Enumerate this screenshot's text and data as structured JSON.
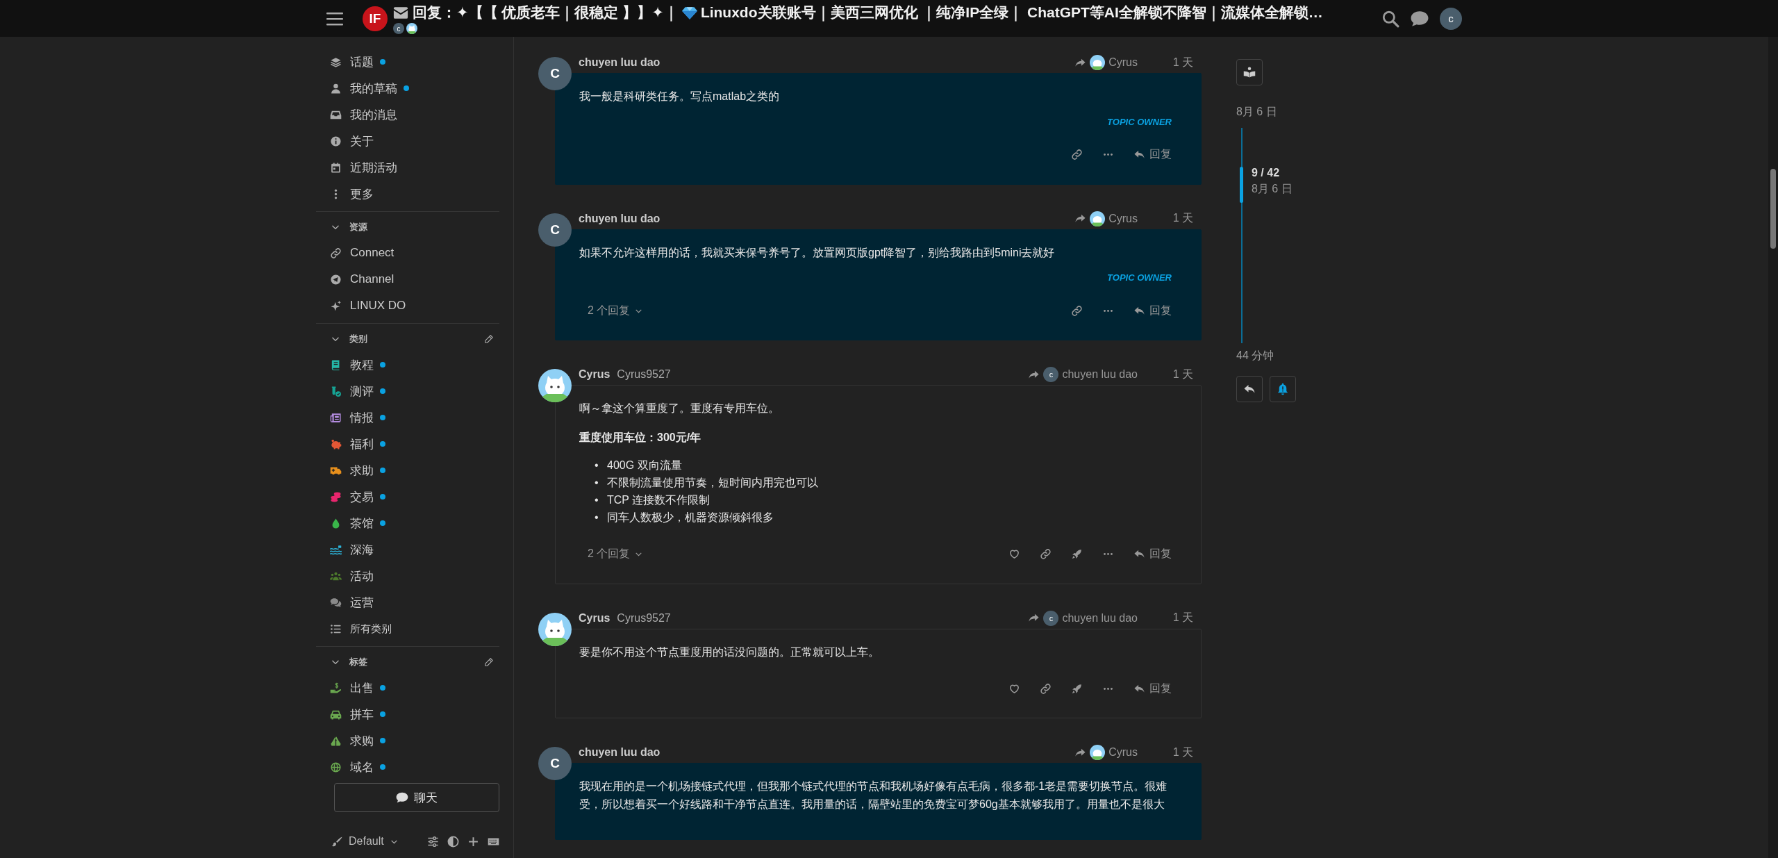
{
  "header": {
    "logo_text": "IF",
    "title_start": "回复：✦【【 优质老车｜很稳定 】】✦｜",
    "title_end": "Linuxdo关联账号｜美西三网优化 ｜纯净IP全绿｜ ChatGPT等AI全解锁不降智｜流媒体全解锁…",
    "participants": [
      {
        "kind": "letter",
        "letter": "c"
      },
      {
        "kind": "cat"
      }
    ],
    "user_letter": "c"
  },
  "sidebar": {
    "items": [
      {
        "label": "话题",
        "unread": true
      },
      {
        "label": "我的草稿",
        "unread": true
      },
      {
        "label": "我的消息",
        "unread": false
      },
      {
        "label": "关于",
        "unread": false
      },
      {
        "label": "近期活动",
        "unread": false
      },
      {
        "label": "更多",
        "unread": false
      }
    ],
    "sections": [
      {
        "title": "资源",
        "expanded": true,
        "editable": false,
        "items": [
          {
            "label": "Connect",
            "unread": false
          },
          {
            "label": "Channel",
            "unread": false
          },
          {
            "label": "LINUX DO",
            "unread": false
          }
        ]
      },
      {
        "title": "类别",
        "expanded": true,
        "editable": true,
        "items": [
          {
            "label": "教程",
            "unread": true,
            "color": "#25b8a8"
          },
          {
            "label": "测评",
            "unread": true,
            "color": "#16a394"
          },
          {
            "label": "情报",
            "unread": true,
            "color": "#b48ce0"
          },
          {
            "label": "福利",
            "unread": true,
            "color": "#e45735"
          },
          {
            "label": "求助",
            "unread": true,
            "color": "#e8901c"
          },
          {
            "label": "交易",
            "unread": true,
            "color": "#e8266e"
          },
          {
            "label": "茶馆",
            "unread": true,
            "color": "#3ab54a"
          },
          {
            "label": "深海",
            "unread": false,
            "color": "#2db3d8"
          },
          {
            "label": "活动",
            "unread": false,
            "color": "#4d7a2c"
          },
          {
            "label": "运营",
            "unread": false,
            "color": "#8a8a8a"
          },
          {
            "label": "所有类别",
            "unread": false
          }
        ]
      },
      {
        "title": "标签",
        "expanded": true,
        "editable": true,
        "items": [
          {
            "label": "出售",
            "unread": true
          },
          {
            "label": "拼车",
            "unread": true
          },
          {
            "label": "求购",
            "unread": true
          },
          {
            "label": "域名",
            "unread": true
          }
        ]
      }
    ],
    "chat_button": "聊天",
    "theme": "Default"
  },
  "posts": [
    {
      "author": "chuyen luu dao",
      "avatar": {
        "kind": "letter",
        "letter": "C"
      },
      "reply_to": {
        "name": "Cyrus",
        "avatar": {
          "kind": "cat"
        }
      },
      "time": "1 天",
      "highlighted": true,
      "body": [
        {
          "kind": "p",
          "text": "我一般是科研类任务。写点matlab之类的"
        }
      ],
      "badge": "TOPIC OWNER",
      "actions": [
        {
          "kind": "link"
        },
        {
          "kind": "more"
        },
        {
          "kind": "reply",
          "label": "回复"
        }
      ]
    },
    {
      "author": "chuyen luu dao",
      "avatar": {
        "kind": "letter",
        "letter": "C"
      },
      "reply_to": {
        "name": "Cyrus",
        "avatar": {
          "kind": "cat"
        }
      },
      "time": "1 天",
      "highlighted": true,
      "body": [
        {
          "kind": "p",
          "text": "如果不允许这样用的话，我就买来保号养号了。放置网页版gpt降智了，别给我路由到5mini去就好"
        }
      ],
      "badge": "TOPIC OWNER",
      "replies": "2 个回复",
      "actions": [
        {
          "kind": "link"
        },
        {
          "kind": "more"
        },
        {
          "kind": "reply",
          "label": "回复"
        }
      ]
    },
    {
      "author": "Cyrus",
      "username": "Cyrus9527",
      "avatar": {
        "kind": "cat"
      },
      "reply_to": {
        "name": "chuyen luu dao",
        "avatar": {
          "kind": "letter",
          "letter": "c"
        }
      },
      "time": "1 天",
      "highlighted": false,
      "body": [
        {
          "kind": "p",
          "text": "啊～拿这个算重度了。重度有专用车位。"
        },
        {
          "kind": "strong",
          "text": "重度使用车位：300元/年"
        },
        {
          "kind": "list",
          "items": [
            {
              "marker": "•",
              "text": "400G 双向流量"
            },
            {
              "marker": "•",
              "text": "不限制流量使用节奏，短时间内用完也可以"
            },
            {
              "marker": "•",
              "text": "TCP 连接数不作限制"
            },
            {
              "marker": "•",
              "text": "同车人数极少，机器资源倾斜很多"
            }
          ]
        }
      ],
      "replies": "2 个回复",
      "actions": [
        {
          "kind": "like"
        },
        {
          "kind": "link"
        },
        {
          "kind": "boost"
        },
        {
          "kind": "more"
        },
        {
          "kind": "reply",
          "label": "回复"
        }
      ]
    },
    {
      "author": "Cyrus",
      "username": "Cyrus9527",
      "avatar": {
        "kind": "cat"
      },
      "reply_to": {
        "name": "chuyen luu dao",
        "avatar": {
          "kind": "letter",
          "letter": "c"
        }
      },
      "time": "1 天",
      "highlighted": false,
      "body": [
        {
          "kind": "p",
          "text": "要是你不用这个节点重度用的话没问题的。正常就可以上车。"
        }
      ],
      "actions": [
        {
          "kind": "like"
        },
        {
          "kind": "link"
        },
        {
          "kind": "boost"
        },
        {
          "kind": "more"
        },
        {
          "kind": "reply",
          "label": "回复"
        }
      ]
    },
    {
      "author": "chuyen luu dao",
      "avatar": {
        "kind": "letter",
        "letter": "C"
      },
      "reply_to": {
        "name": "Cyrus",
        "avatar": {
          "kind": "cat"
        }
      },
      "time": "1 天",
      "highlighted": true,
      "body": [
        {
          "kind": "p",
          "text": "我现在用的是一个机场接链式代理，但我那个链式代理的节点和我机场好像有点毛病，很多都-1老是需要切换节点。很难受，所以想着买一个好线路和干净节点直连。我用量的话，隔壁站里的免费宝可梦60g基本就够我用了。用量也不是很大"
        }
      ]
    }
  ],
  "timeline": {
    "start_date": "8月 6 日",
    "position": "9 / 42",
    "current_date": "8月 6 日",
    "end": "44 分钟",
    "notify_on": true
  }
}
